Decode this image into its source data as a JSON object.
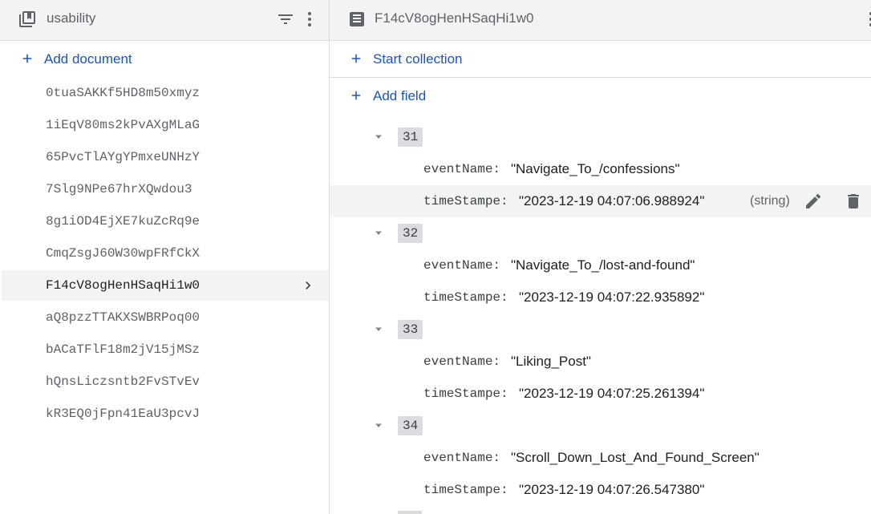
{
  "collection": {
    "title": "usability",
    "icons": [
      "collection-icon",
      "filter-icon",
      "more-vert-icon"
    ],
    "add_label": "Add document",
    "documents": [
      "0tuaSAKKf5HD8m50xmyz",
      "1iEqV80ms2kPvAXgMLaG",
      "65PvcTlAYgYPmxeUNHzY",
      "7Slg9NPe67hrXQwdou3",
      "8g1iOD4EjXE7kuZcRq9e",
      "CmqZsgJ60W30wpFRfCkX",
      "F14cV8ogHenHSaqHi1w0",
      "aQ8pzzTTAKXSWBRPoq00",
      "bACaTFlF18m2jV15jMSz",
      "hQnsLiczsntb2FvSTvEv",
      "kR3EQ0jFpn41EaU3pcvJ"
    ],
    "selected_index": 6
  },
  "document": {
    "title": "F14cV8ogHenHSaqHi1w0",
    "icons": [
      "document-icon",
      "more-vert-icon"
    ],
    "start_collection_label": "Start collection",
    "add_field_label": "Add field",
    "entries": [
      {
        "key": "31",
        "eventName_label": "eventName:",
        "eventName": "\"Navigate_To_/confessions\"",
        "timeStampe_label": "timeStampe:",
        "timeStampe": "\"2023-12-19 04:07:06.988924\""
      },
      {
        "key": "32",
        "eventName_label": "eventName:",
        "eventName": "\"Navigate_To_/lost-and-found\"",
        "timeStampe_label": "timeStampe:",
        "timeStampe": "\"2023-12-19 04:07:22.935892\""
      },
      {
        "key": "33",
        "eventName_label": "eventName:",
        "eventName": "\"Liking_Post\"",
        "timeStampe_label": "timeStampe:",
        "timeStampe": "\"2023-12-19 04:07:25.261394\""
      },
      {
        "key": "34",
        "eventName_label": "eventName:",
        "eventName": "\"Scroll_Down_Lost_And_Found_Screen\"",
        "timeStampe_label": "timeStampe:",
        "timeStampe": "\"2023-12-19 04:07:26.547380\""
      }
    ],
    "hovered_type": "(string)",
    "hover_icons": [
      "edit-icon",
      "delete-icon"
    ]
  },
  "colors": {
    "link": "#1a56b8",
    "header_bg": "#f1f3f4",
    "selected_bg": "#f1f3f4",
    "badge_bg": "#dadce0",
    "divider": "#dadce0"
  }
}
